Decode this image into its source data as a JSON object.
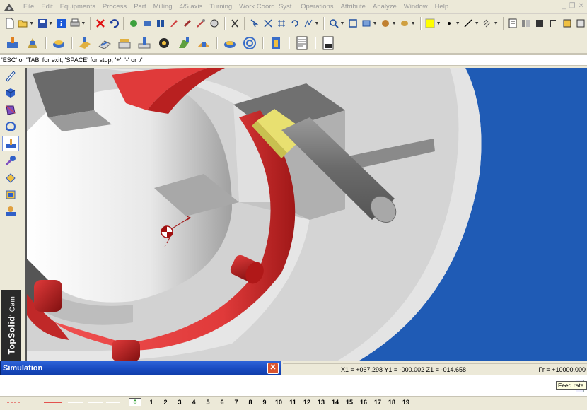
{
  "menu": {
    "items": [
      "File",
      "Edit",
      "Equipments",
      "Process",
      "Part",
      "Milling",
      "4/5 axis",
      "Turning",
      "Work Coord. Syst.",
      "Operations",
      "Attribute",
      "Analyze",
      "Window",
      "Help"
    ]
  },
  "prompt": {
    "text": "'ESC' or 'TAB' for exit, 'SPACE' for stop, '+', '-' or '/'"
  },
  "status": {
    "coords": "X1 = +067.298   Y1 = -000.002   Z1 = -014.658",
    "feed": "Fr = +10000.000"
  },
  "tooltip": {
    "text": "Feed rate"
  },
  "brand": {
    "name": "TopSolid",
    "suffix": "' Cam"
  },
  "simulation": {
    "title": "Simulation",
    "close_label": "✕",
    "slider_position": 0.48
  },
  "layers": {
    "current": "0",
    "items": [
      "1",
      "2",
      "3",
      "4",
      "5",
      "6",
      "7",
      "8",
      "9",
      "10",
      "11",
      "12",
      "13",
      "14",
      "15",
      "16",
      "17",
      "18",
      "19"
    ]
  },
  "colors": {
    "red_part": "#e03a3a",
    "tool": "#808080",
    "tool_holder_yellow": "#e8e070",
    "blue_background": "#1f5bb5",
    "titlebar": "#1a4cc2"
  },
  "icons": {
    "app": "topsolid-icon",
    "toolbar1": [
      "new-icon",
      "open-icon",
      "save-icon",
      "info-icon",
      "print-icon",
      "delete-icon",
      "undo-icon",
      "tools-icon"
    ],
    "palette": [
      "pencil-icon",
      "cube-icon",
      "surface-icon",
      "assembly-icon",
      "machining-icon",
      "tool-icon",
      "stock-icon",
      "fixture-icon",
      "simulation-icon"
    ]
  }
}
